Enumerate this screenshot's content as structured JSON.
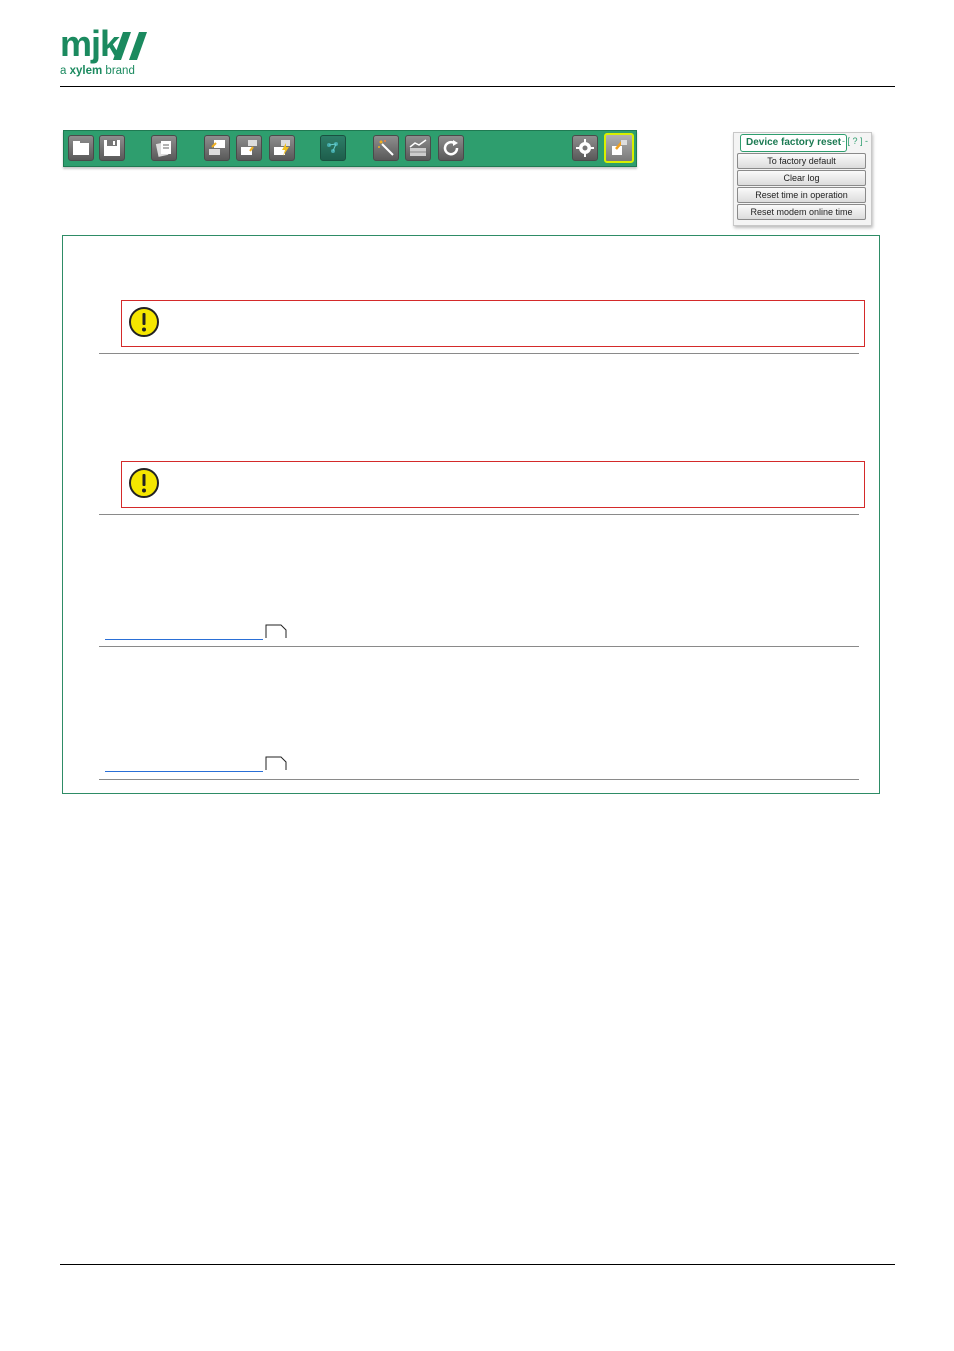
{
  "header": {
    "logo_text": "mjk",
    "logo_sub_prefix": "a",
    "logo_sub_brand": "xylem",
    "logo_sub_suffix": "brand"
  },
  "colors": {
    "brand_green": "#1b8a5f",
    "toolbar_green": "#2e9e6e",
    "warning_red": "#d42a2a",
    "warning_yellow": "#f5e600",
    "link_blue": "#2a6fd6"
  },
  "toolbar": {
    "buttons": [
      {
        "icon": "folder-open-icon"
      },
      {
        "icon": "save-icon"
      },
      {
        "icon": "documents-icon"
      },
      {
        "icon": "read-device-icon"
      },
      {
        "icon": "write-device-icon"
      },
      {
        "icon": "connect-device-icon"
      },
      {
        "icon": "circuit-board-icon"
      },
      {
        "icon": "wizard-wand-icon"
      },
      {
        "icon": "chart-log-icon"
      },
      {
        "icon": "refresh-icon"
      },
      {
        "icon": "gear-icon"
      },
      {
        "icon": "factory-reset-icon"
      }
    ]
  },
  "reset_panel": {
    "title": "Device factory reset",
    "help": "- [ ? ] -",
    "buttons": [
      "To factory default",
      "Clear log",
      "Reset time in operation",
      "Reset modem online time"
    ]
  }
}
